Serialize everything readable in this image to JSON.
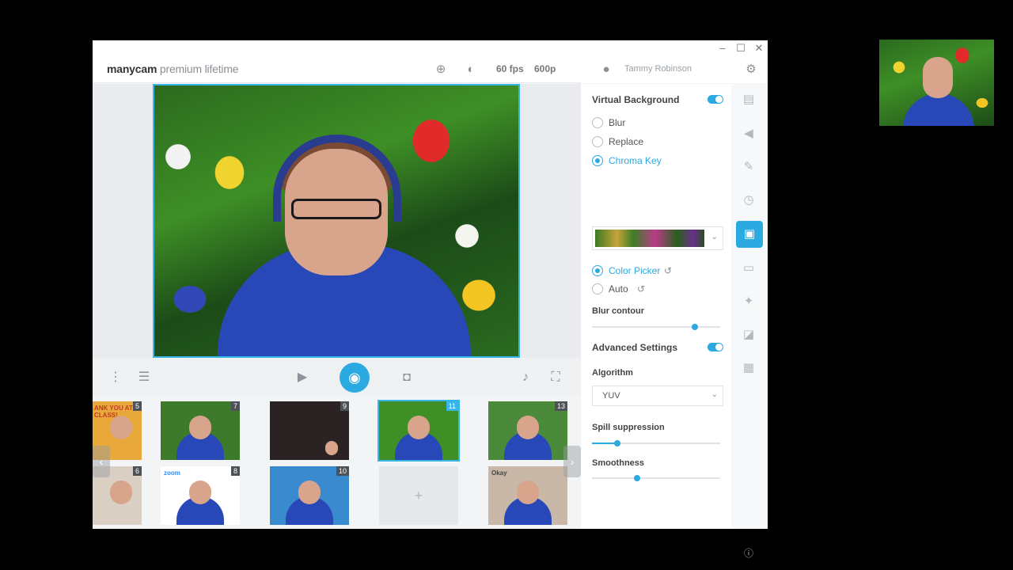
{
  "app": {
    "brand_bold": "manycam",
    "brand_light": " premium lifetime",
    "fps": "60 fps",
    "resolution": "600p",
    "user_name": "Tammy Robinson"
  },
  "window_controls": {
    "minimize": "–",
    "maximize": "☐",
    "close": "✕"
  },
  "panel": {
    "virtual_background_label": "Virtual Background",
    "virtual_background_on": true,
    "modes": [
      {
        "label": "Blur",
        "selected": false
      },
      {
        "label": "Replace",
        "selected": false
      },
      {
        "label": "Chroma Key",
        "selected": true
      }
    ],
    "color_modes": [
      {
        "label": "Color Picker",
        "selected": true
      },
      {
        "label": "Auto",
        "selected": false
      }
    ],
    "blur_contour_label": "Blur contour",
    "blur_contour_value": 0.8,
    "advanced_settings_label": "Advanced Settings",
    "advanced_settings_on": true,
    "algorithm_label": "Algorithm",
    "algorithm_value": "YUV",
    "spill_suppression_label": "Spill suppression",
    "spill_suppression_value": 0.2,
    "smoothness_label": "Smoothness",
    "smoothness_value": 0.35
  },
  "thumbnails": [
    {
      "num": "5",
      "text": "ANK YOU AT CLASS!"
    },
    {
      "num": "7",
      "text": ""
    },
    {
      "num": "9",
      "text": ""
    },
    {
      "num": "11",
      "text": "",
      "selected": true
    },
    {
      "num": "13",
      "text": ""
    },
    {
      "num": "6",
      "text": ""
    },
    {
      "num": "8",
      "text": "zoom"
    },
    {
      "num": "10",
      "text": ""
    },
    {
      "num": "",
      "text": "+"
    },
    {
      "num": "",
      "text": "Okay"
    }
  ],
  "icons": {
    "zoom": "zoom-icon",
    "brightness": "brightness-icon",
    "settings": "gear-icon",
    "user_status": "user-icon",
    "camera": "video-camera-icon",
    "broadcast": "broadcast-icon",
    "snapshot": "camera-icon",
    "mic": "mic-icon",
    "fullscreen": "fullscreen-icon",
    "menu": "more-vertical-icon",
    "playlist": "playlist-icon",
    "info": "info-icon"
  },
  "colors": {
    "accent": "#2ba9e1",
    "selection": "#38b6e8"
  }
}
